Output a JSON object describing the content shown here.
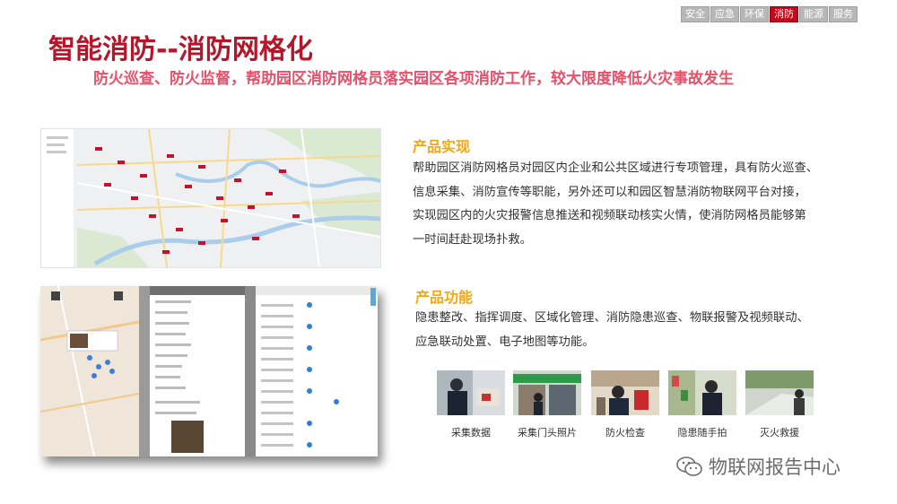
{
  "nav": {
    "tabs": [
      {
        "label": "安全",
        "active": false
      },
      {
        "label": "应急",
        "active": false
      },
      {
        "label": "环保",
        "active": false
      },
      {
        "label": "消防",
        "active": true
      },
      {
        "label": "能源",
        "active": false
      },
      {
        "label": "服务",
        "active": false
      }
    ],
    "active_color": "#c3091a",
    "inactive_color": "#b7b7b7"
  },
  "title": "智能消防--消防网格化",
  "subtitle": "防火巡查、防火监督，帮助园区消防网格员落实园区各项消防工作，较大限度降低火灾事故发生",
  "section1": {
    "heading": "产品实现",
    "lines": [
      "帮助园区消防网格员对园区内企业和公共区域进行专项管理，具有防火巡查、",
      "信息采集、消防宣传等职能，另外还可以和园区智慧消防物联网平台对接，",
      "实现园区内的火灾报警信息推送和视频联动核实火情，使消防网格员能够第",
      "一时间赶赴现场扑救。"
    ]
  },
  "section2": {
    "heading": "产品功能",
    "lines": [
      "隐患整改、指挥调度、区域化管理、消防隐患巡查、物联报警及视频联动、",
      "应急联动处置、电子地图等功能。"
    ]
  },
  "photos": [
    {
      "caption": "采集数据",
      "icon": "data-collection-photo"
    },
    {
      "caption": "采集门头照片",
      "icon": "storefront-photo"
    },
    {
      "caption": "防火检查",
      "icon": "fire-inspection-photo"
    },
    {
      "caption": "隐患随手拍",
      "icon": "hazard-snapshot-photo"
    },
    {
      "caption": "灭火救援",
      "icon": "fire-rescue-photo"
    }
  ],
  "watermark": {
    "text": "物联网报告中心",
    "icon": "wechat-icon"
  },
  "colors": {
    "title": "#b4162b",
    "subtitle": "#e8506a",
    "heading": "#f5a70f"
  }
}
